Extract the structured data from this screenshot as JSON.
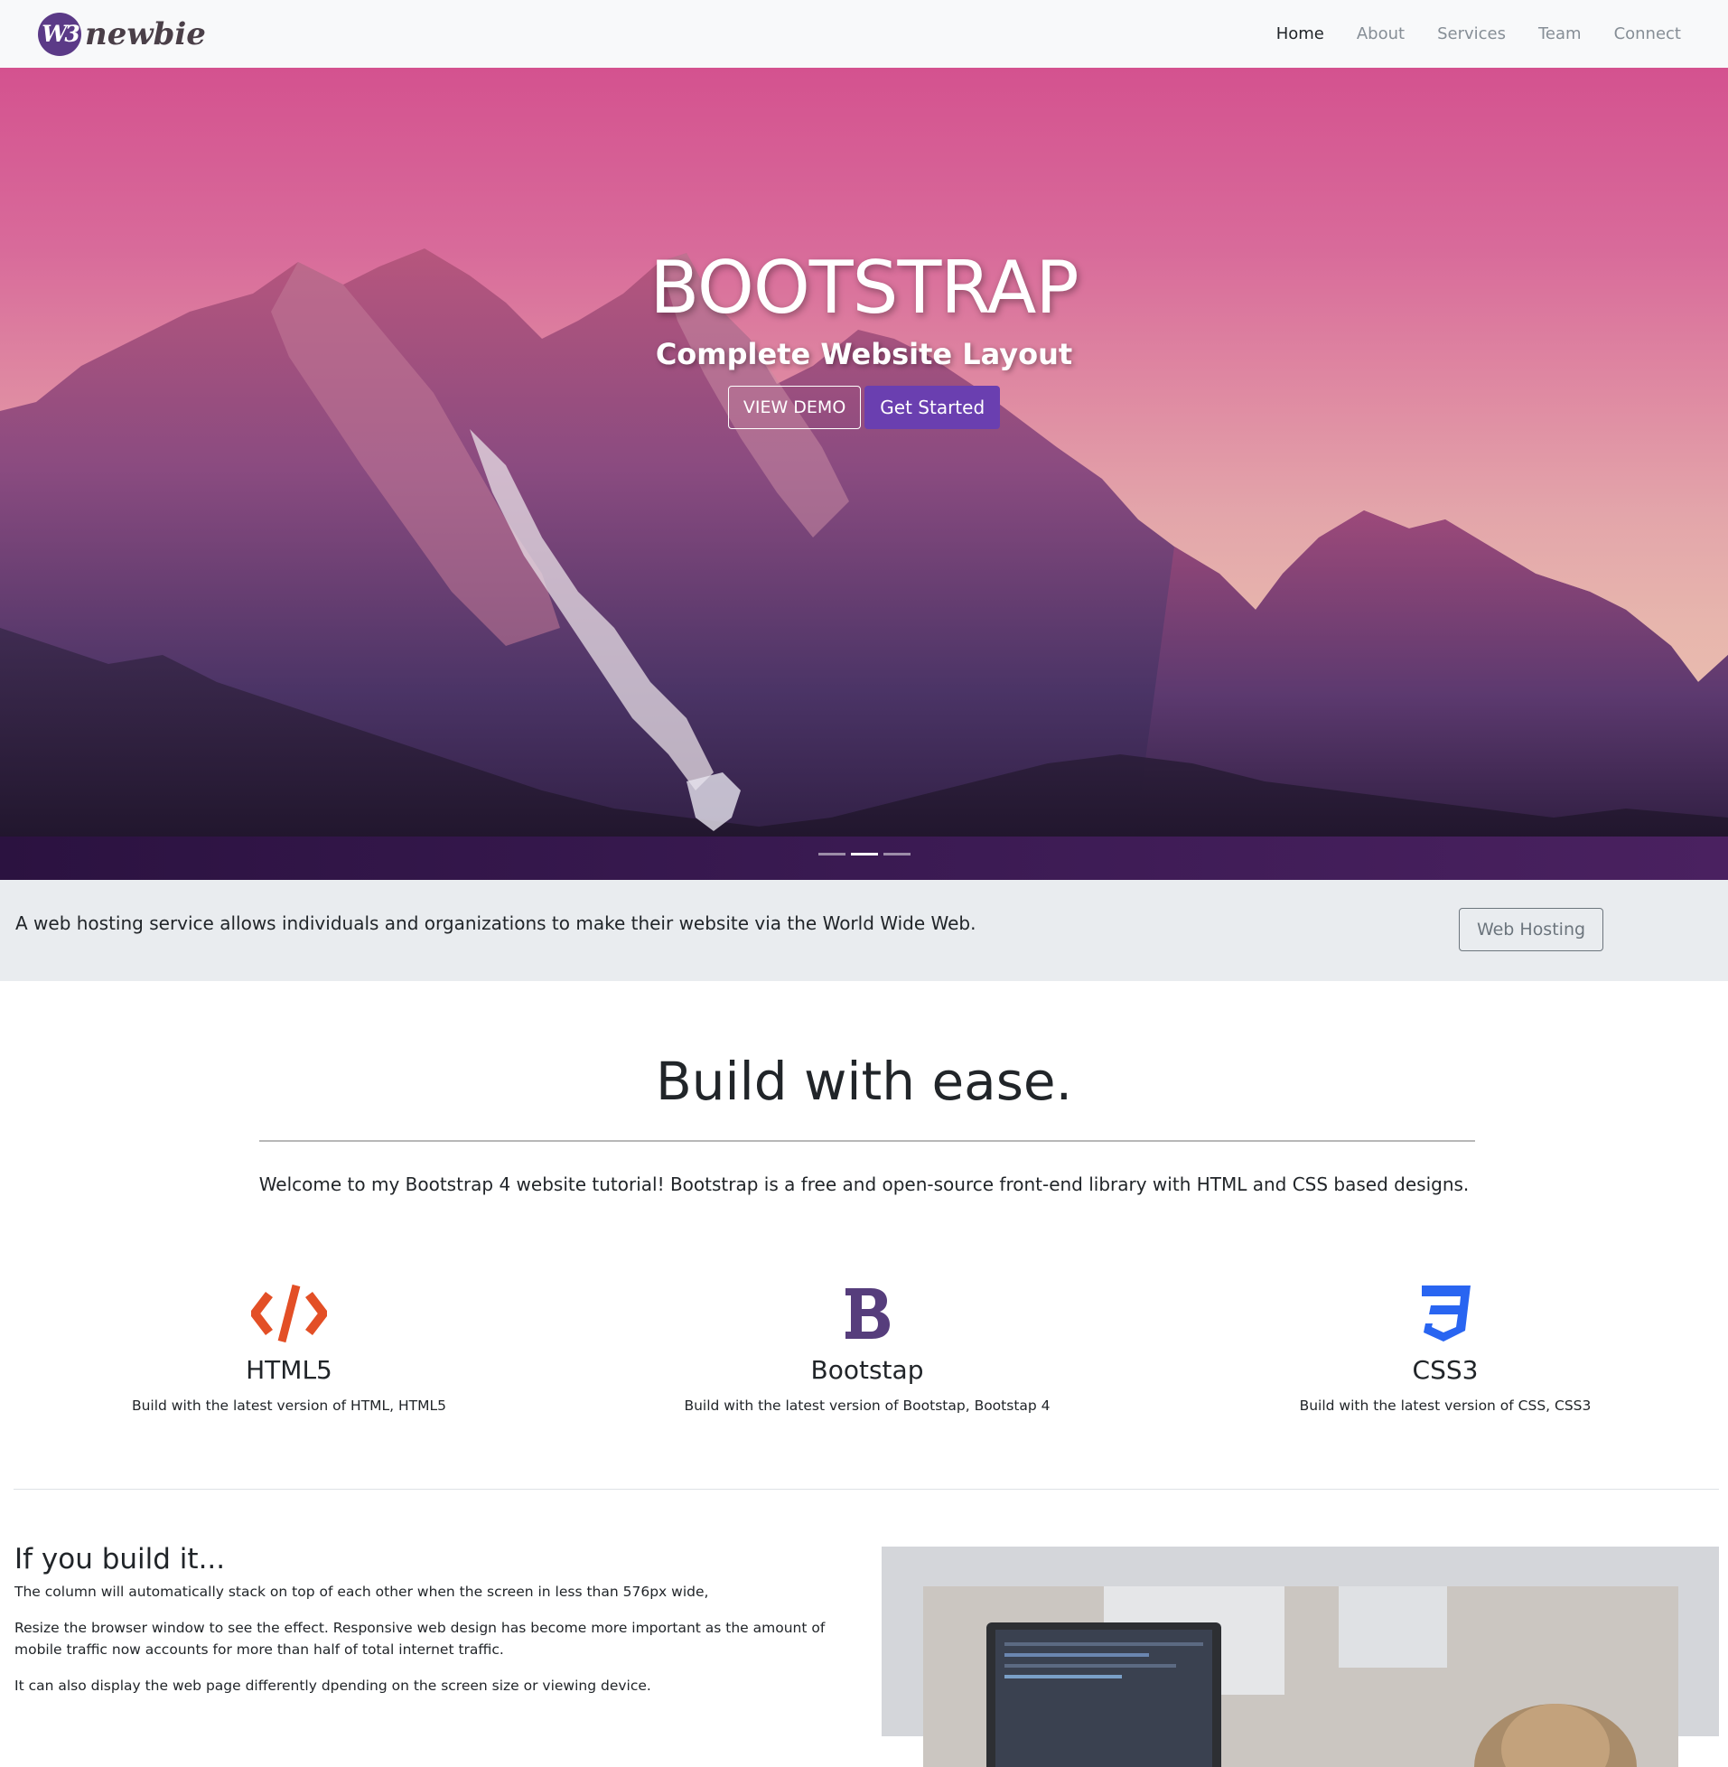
{
  "navbar": {
    "brand_badge": "W3",
    "brand_name": "newbie",
    "links": [
      "Home",
      "About",
      "Services",
      "Team",
      "Connect"
    ],
    "active": "Home"
  },
  "hero": {
    "title": "BOOTSTRAP",
    "subtitle": "Complete Website Layout",
    "btn_demo": "VIEW DEMO",
    "btn_start": "Get Started",
    "slide_count": 3,
    "active_slide": 2
  },
  "strip": {
    "text": "A web hosting service allows individuals and organizations to make their website via the World Wide Web.",
    "button": "Web Hosting"
  },
  "welcome": {
    "title": "Build with ease.",
    "text": "Welcome to my Bootstrap 4 website tutorial! Bootstrap is a free and open-source front-end library with HTML and CSS based designs."
  },
  "features": [
    {
      "icon": "html5-code-icon",
      "title": "HTML5",
      "desc": "Build with the latest version of HTML, HTML5"
    },
    {
      "icon": "bootstrap-icon",
      "title": "Bootstap",
      "desc": "Build with the latest version of Bootstap, Bootstap 4"
    },
    {
      "icon": "css3-icon",
      "title": "CSS3",
      "desc": "Build with the latest version of CSS, CSS3"
    }
  ],
  "about": {
    "title": "If you build it...",
    "p1": "The column will automatically stack on top of each other when the screen in less than 576px wide,",
    "p2": "Resize the browser window to see the effect. Responsive web design has become more important as the amount of mobile traffic now accounts for more than half of total internet traffic.",
    "p3": "It can also display the web page differently dpending on the screen size or viewing device."
  },
  "colors": {
    "brand_purple": "#5b3a87",
    "primary_button": "#6a3fb0",
    "html5_orange": "#e34f26",
    "bootstrap_purple": "#563d7c",
    "css3_blue": "#2965f1"
  }
}
